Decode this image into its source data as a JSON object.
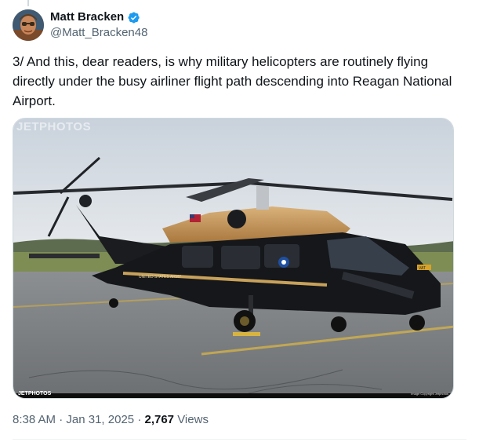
{
  "author": {
    "display_name": "Matt Bracken",
    "handle": "@Matt_Bracken48",
    "verified": true,
    "avatar_icon": "avatar-portrait"
  },
  "tweet": {
    "text": "3/ And this, dear readers, is why military helicopters are routinely flying directly under the busy airliner flight path descending into Reagan National Airport."
  },
  "media": {
    "description_icon": "helicopter-photo",
    "watermark_top": "JETPHOTOS",
    "watermark_bottom": "JETPHOTOS",
    "watermark_corner": "Image Copyright Jetphotos",
    "tail_marking": "UNITED STATES ARMY",
    "chock_text": "VAT"
  },
  "meta": {
    "time": "8:38 AM",
    "separator": "·",
    "date": "Jan 31, 2025",
    "views_count": "2,767",
    "views_label": "Views"
  },
  "colors": {
    "verified_blue": "#1d9bf0",
    "text_secondary": "#536471",
    "text_primary": "#0f1419"
  }
}
